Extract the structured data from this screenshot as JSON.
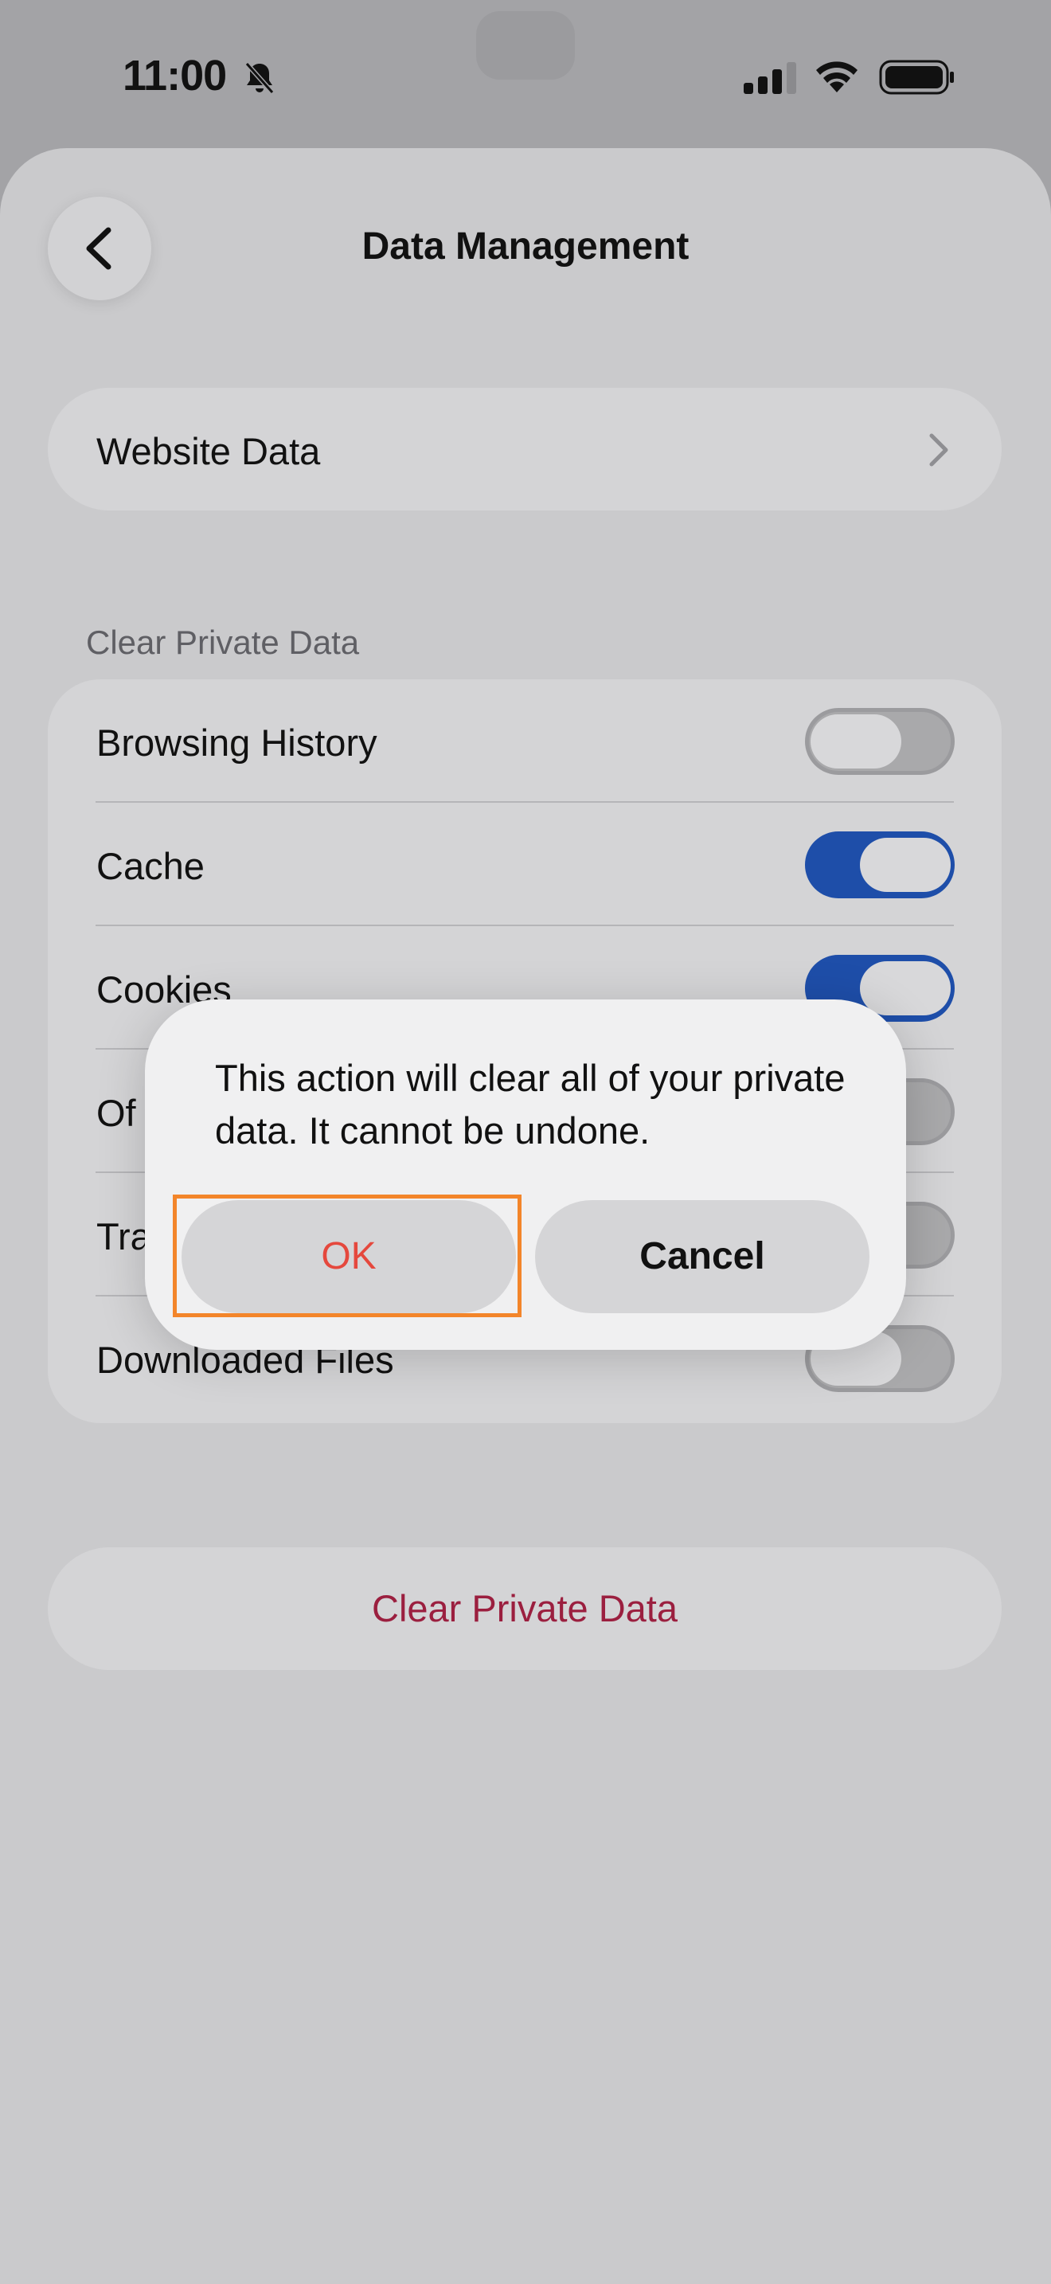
{
  "status_bar": {
    "time": "11:00",
    "icons": [
      "bell-slash-icon",
      "cellular-signal-icon",
      "wifi-icon",
      "battery-icon"
    ]
  },
  "header": {
    "title": "Data Management",
    "back_icon": "chevron-left-icon"
  },
  "website_data": {
    "label": "Website Data",
    "chevron_icon": "chevron-right-icon"
  },
  "clear_section": {
    "header": "Clear Private Data",
    "items": [
      {
        "label": "Browsing History",
        "enabled": false
      },
      {
        "label": "Cache",
        "enabled": true
      },
      {
        "label": "Cookies",
        "enabled": true
      },
      {
        "label": "Of",
        "enabled": false
      },
      {
        "label": "Tra",
        "enabled": false
      },
      {
        "label": "Downloaded Files",
        "enabled": false
      }
    ]
  },
  "clear_button": {
    "label": "Clear Private Data"
  },
  "dialog": {
    "message": "This action will clear all of your private data. It cannot be undone.",
    "ok_label": "OK",
    "cancel_label": "Cancel"
  },
  "colors": {
    "toggle_on": "#1e4ea9",
    "destructive": "#9b1f3f",
    "ok_text": "#e5483d",
    "highlight": "#f3852a"
  }
}
